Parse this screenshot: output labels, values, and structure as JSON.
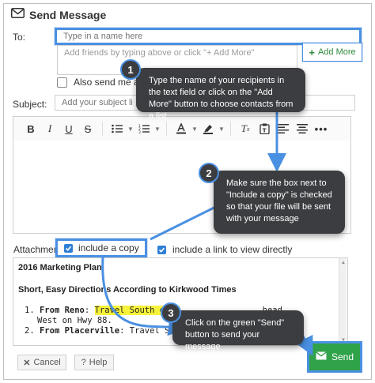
{
  "dialog": {
    "title": "Send Message"
  },
  "to": {
    "label": "To:",
    "placeholder": "Type in a name here",
    "friends_placeholder": "Add friends by typing above or click \"+ Add More\"",
    "add_more_label": "Add More",
    "also_send_label": "Also send me a"
  },
  "subject": {
    "label": "Subject:",
    "placeholder": "Add your subject li"
  },
  "attachment": {
    "label": "Attachment :",
    "include_copy_label": "include a copy",
    "include_link_label": "include a link to view directly"
  },
  "document": {
    "heading": "2016 Marketing Plan",
    "subheading": "Short, Easy Directions According to Kirkwood Times",
    "items": [
      {
        "number": "1.",
        "bold": "From Reno",
        "text_before": ": ",
        "highlight": "Travel South on H",
        "text_after": ", head"
      },
      {
        "number": "",
        "bold": "",
        "text_before": "West on Hwy 88.",
        "highlight": "",
        "text_after": ""
      },
      {
        "number": "2.",
        "bold": "From Placerville",
        "text_before": ": Travel South on",
        "highlight": "",
        "text_after": ""
      }
    ]
  },
  "buttons": {
    "cancel": "Cancel",
    "help": "Help",
    "send": "Send"
  },
  "callouts": [
    {
      "number": "1",
      "text": "Type the name of your recipients in the text field or click on the \"Add More\" button to choose contacts from a list"
    },
    {
      "number": "2",
      "text": "Make sure the box next to \"Include a copy\" is checked so that your file will be sent with your message"
    },
    {
      "number": "3",
      "text": "Click on the green \"Send\" button to send your message"
    }
  ],
  "colors": {
    "highlight_blue": "#4a90e2",
    "callout_bg": "#3b3d40",
    "add_more_green": "#2e8b3a",
    "send_green": "#2fa24a",
    "checkbox_blue": "#2f7fd6",
    "text_highlight": "#f7f23a"
  }
}
